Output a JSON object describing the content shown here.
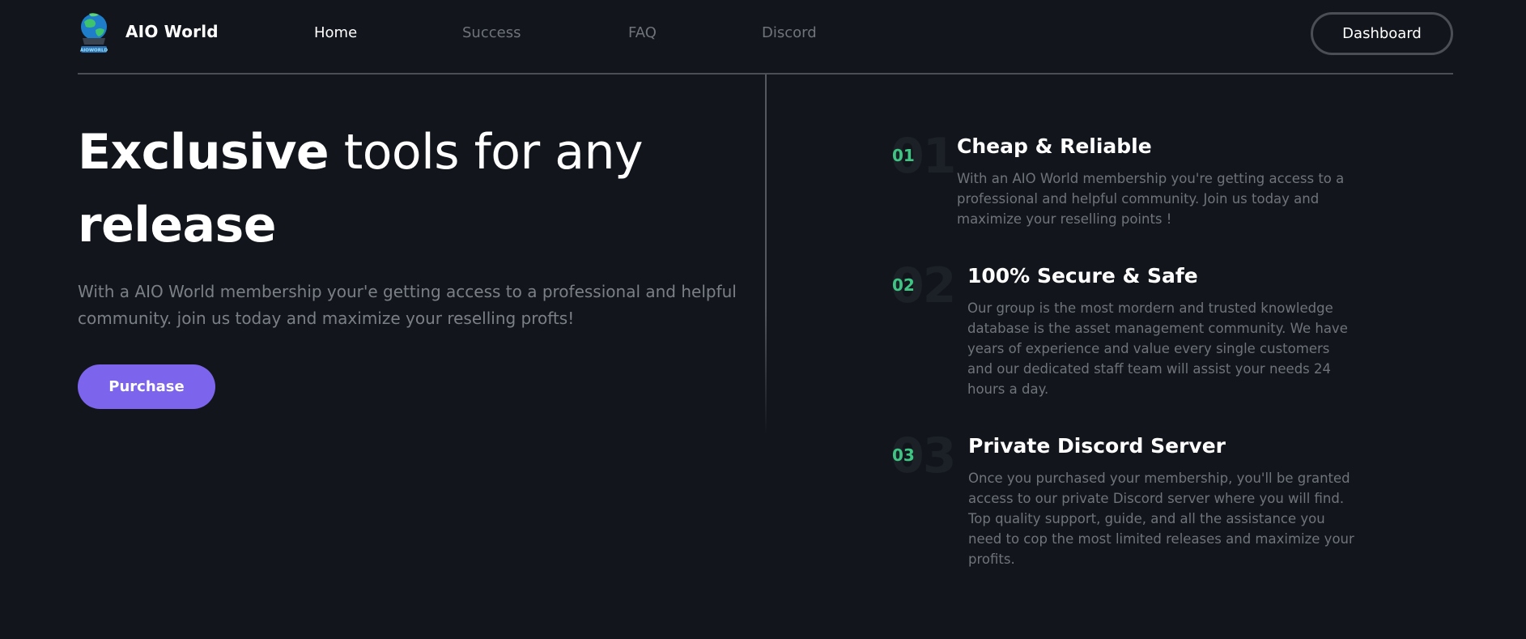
{
  "header": {
    "brand": "AIO World",
    "logo_text": "AIOWORLD",
    "nav": [
      {
        "label": "Home",
        "active": true
      },
      {
        "label": "Success",
        "active": false
      },
      {
        "label": "FAQ",
        "active": false
      },
      {
        "label": "Discord",
        "active": false
      }
    ],
    "dashboard_label": "Dashboard"
  },
  "hero": {
    "title_bold": "Exclusive",
    "title_rest": " tools for any",
    "title_line2": "release",
    "description": "With a AIO World membership your'e getting access to a professional and helpful community. join us today and maximize your reselling profts!",
    "purchase_label": "Purchase"
  },
  "features": [
    {
      "number": "01",
      "title": "Cheap & Reliable",
      "text": "With an AIO World membership you're getting access to a professional and helpful community. Join us today and maximize your reselling points !"
    },
    {
      "number": "02",
      "title": "100% Secure & Safe",
      "text": "Our group is the most mordern and trusted knowledge database is the asset management community. We have years of experience and value every single customers and our dedicated staff team will assist your needs 24 hours a day."
    },
    {
      "number": "03",
      "title": "Private Discord Server",
      "text": "Once you purchased your membership, you'll be granted access to our private Discord server where you will find. Top quality support, guide, and all the assistance you need to cop the most limited releases and maximize your profits."
    }
  ],
  "colors": {
    "background": "#12161c",
    "accent_purple": "#7c64ec",
    "accent_green": "#3ec483",
    "muted_text": "#6f737a"
  },
  "icons": {
    "logo": "globe-logo-icon"
  }
}
